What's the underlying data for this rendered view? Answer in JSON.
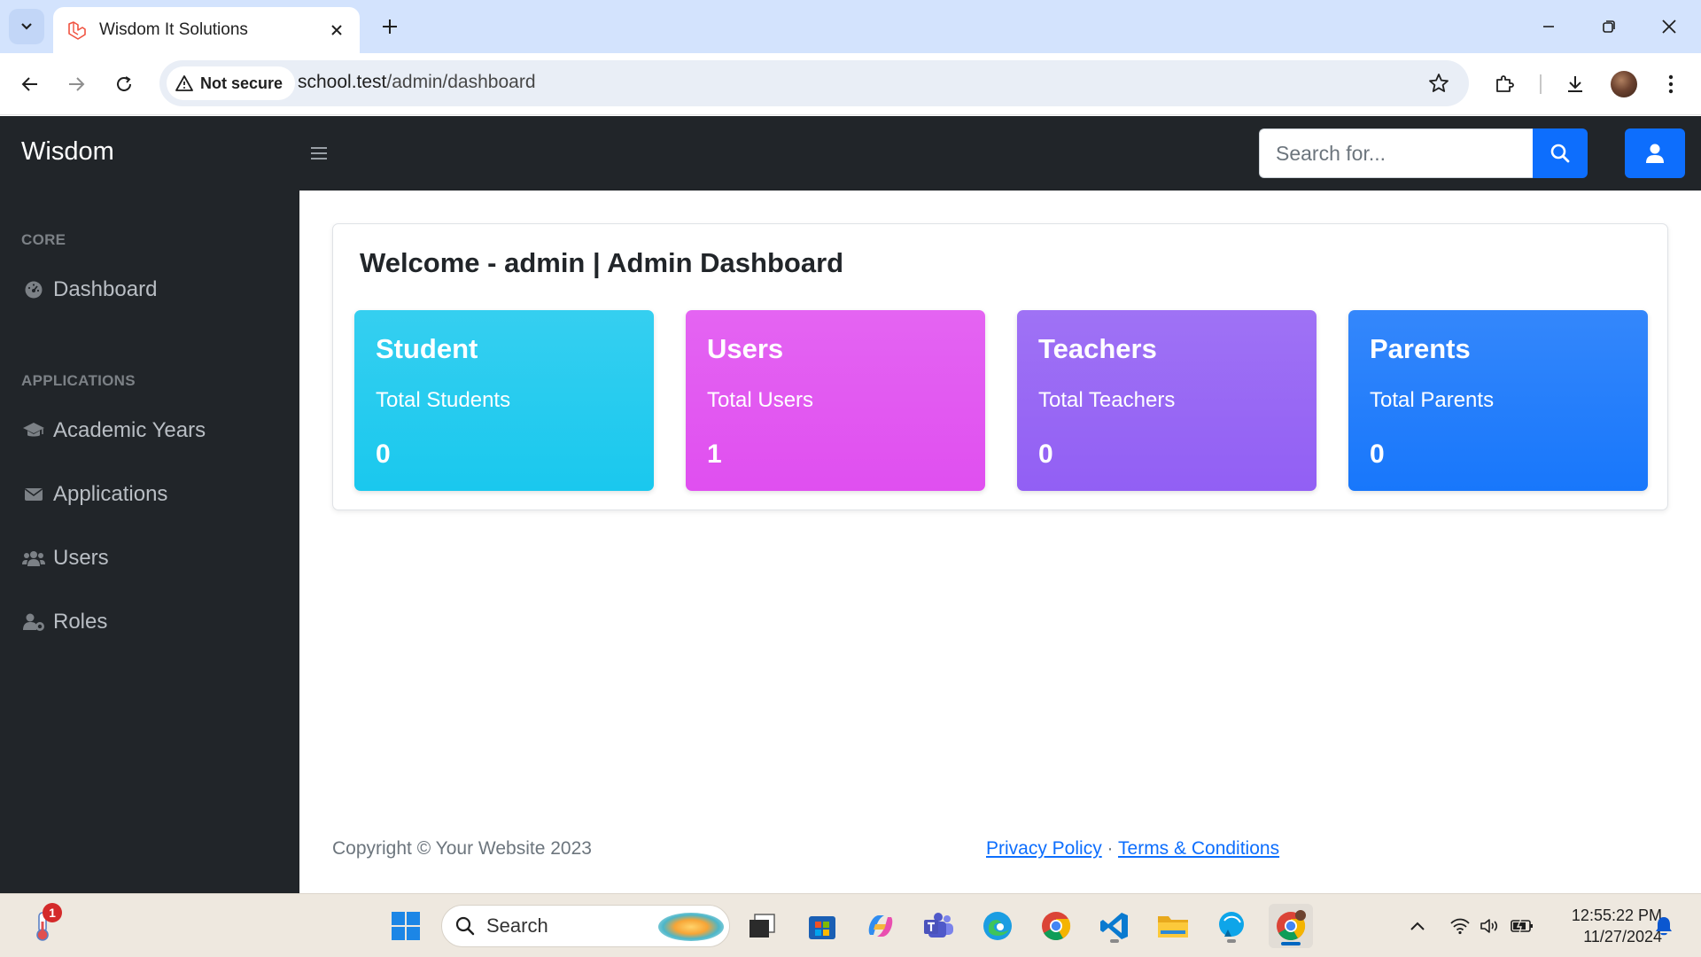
{
  "browser": {
    "tab_title": "Wisdom It Solutions",
    "security_label": "Not secure",
    "url_host": "school.test",
    "url_path": "/admin/dashboard"
  },
  "app": {
    "brand": "Wisdom",
    "search_placeholder": "Search for...",
    "sidebar": {
      "sections": [
        {
          "heading": "CORE",
          "items": [
            {
              "label": "Dashboard",
              "icon": "dashboard-gauge-icon"
            }
          ]
        },
        {
          "heading": "APPLICATIONS",
          "items": [
            {
              "label": "Academic Years",
              "icon": "graduation-cap-icon"
            },
            {
              "label": "Applications",
              "icon": "envelope-icon"
            },
            {
              "label": "Users",
              "icon": "users-icon"
            },
            {
              "label": "Roles",
              "icon": "user-role-icon"
            }
          ]
        }
      ]
    },
    "main": {
      "welcome_title": "Welcome - admin | Admin Dashboard",
      "stats": [
        {
          "title": "Student",
          "subtitle": "Total Students",
          "value": "0",
          "color": "#1ac8ee"
        },
        {
          "title": "Users",
          "subtitle": "Total Users",
          "value": "1",
          "color": "#e04ff0"
        },
        {
          "title": "Teachers",
          "subtitle": "Total Teachers",
          "value": "0",
          "color": "#925ff4"
        },
        {
          "title": "Parents",
          "subtitle": "Total Parents",
          "value": "0",
          "color": "#1877fb"
        }
      ]
    },
    "footer": {
      "copyright": "Copyright © Your Website 2023",
      "privacy": "Privacy Policy",
      "separator": "·",
      "terms": "Terms & Conditions"
    }
  },
  "taskbar": {
    "search_label": "Search",
    "weather_badge": "1",
    "time": "12:55:22 PM",
    "date": "11/27/2024"
  },
  "colors": {
    "nav_dark": "#212529",
    "primary": "#0d6efd",
    "tabstrip": "#d3e3fd"
  }
}
